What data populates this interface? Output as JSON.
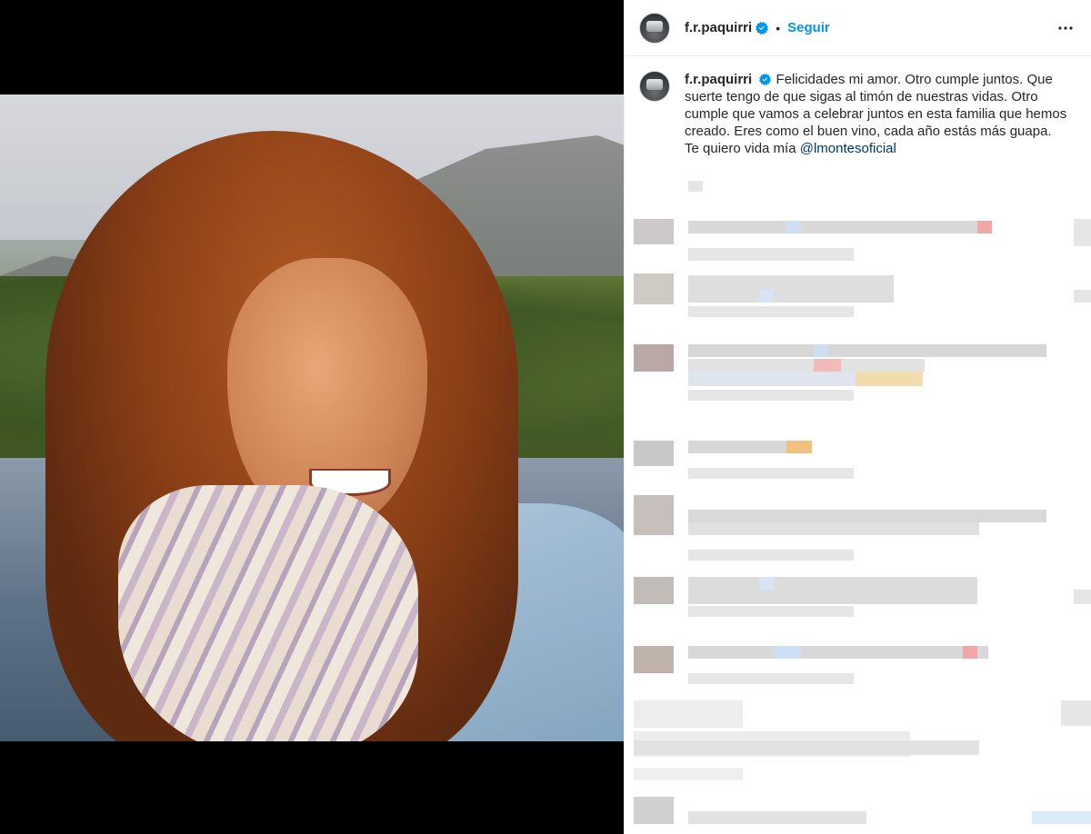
{
  "post": {
    "username": "f.r.paquirri",
    "separator": "•",
    "follow_label": "Seguir",
    "more_icon": "more-horizontal-icon",
    "verified_icon": "verified-badge-icon",
    "colors": {
      "accent": "#0095f6",
      "mention": "#00376b",
      "text": "#262626"
    }
  },
  "caption": {
    "username": "f.r.paquirri",
    "text": "Felicidades mi amor. Otro cumple juntos. Que suerte tengo de que sigas al timón de nuestras vidas. Otro cumple que vamos a celebrar juntos en esta familia que hemos creado. Eres como el buen vino, cada año estás más guapa.",
    "line2_prefix": "Te quiero vida mía ",
    "mention": "@lmontesoficial"
  }
}
